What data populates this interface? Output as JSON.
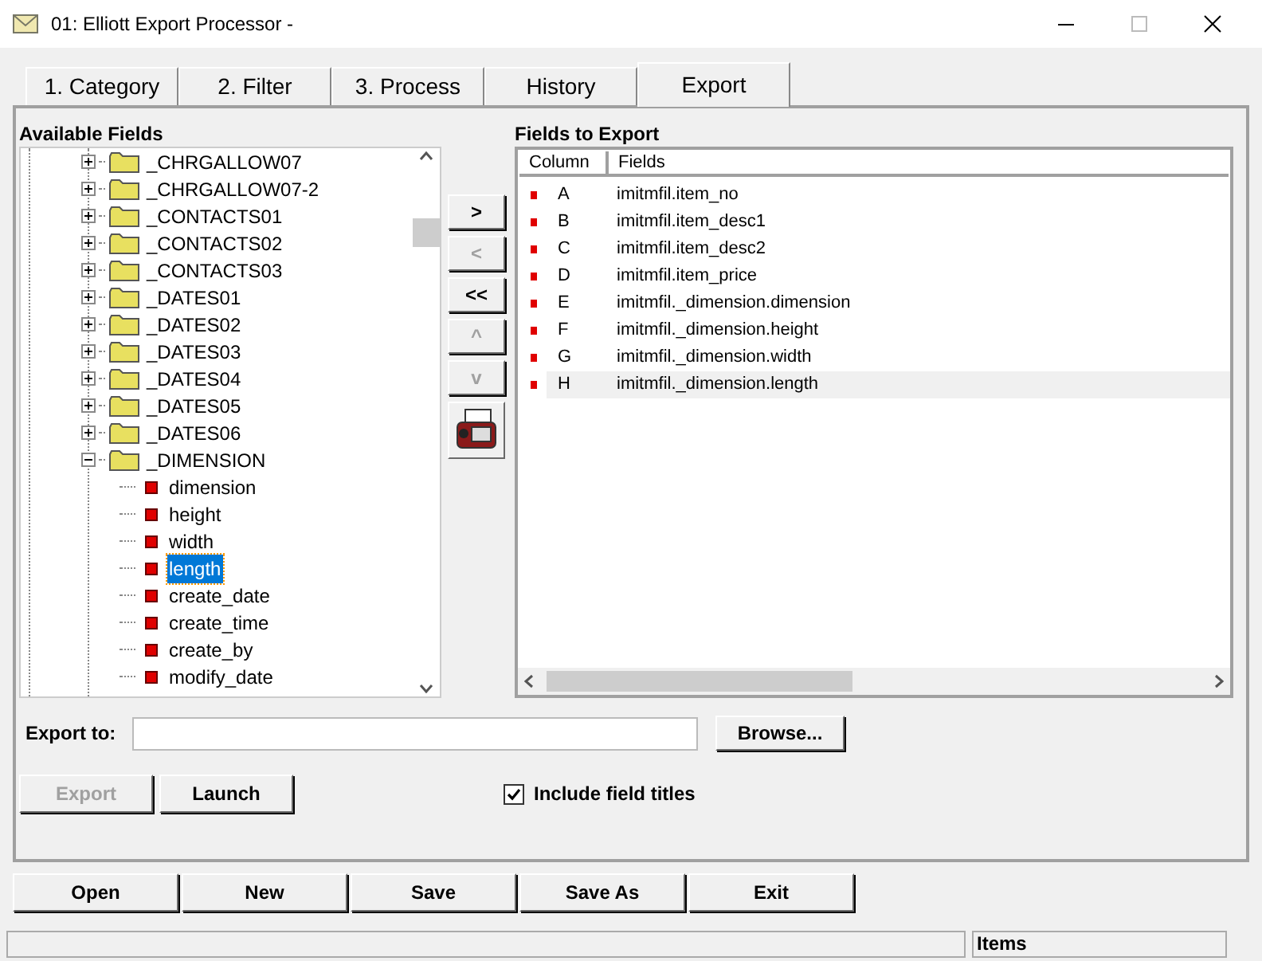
{
  "window": {
    "title": "01: Elliott Export Processor -"
  },
  "tabs": [
    {
      "label": "1. Category",
      "selected": false
    },
    {
      "label": "2. Filter",
      "selected": false
    },
    {
      "label": "3. Process",
      "selected": false
    },
    {
      "label": "History",
      "selected": false
    },
    {
      "label": "Export",
      "selected": true
    }
  ],
  "available_fields": {
    "label": "Available Fields",
    "items": [
      {
        "label": "_CHRGALLOW07",
        "expanded": false
      },
      {
        "label": "_CHRGALLOW07-2",
        "expanded": false
      },
      {
        "label": "_CONTACTS01",
        "expanded": false
      },
      {
        "label": "_CONTACTS02",
        "expanded": false
      },
      {
        "label": "_CONTACTS03",
        "expanded": false
      },
      {
        "label": "_DATES01",
        "expanded": false
      },
      {
        "label": "_DATES02",
        "expanded": false
      },
      {
        "label": "_DATES03",
        "expanded": false
      },
      {
        "label": "_DATES04",
        "expanded": false
      },
      {
        "label": "_DATES05",
        "expanded": false
      },
      {
        "label": "_DATES06",
        "expanded": false
      },
      {
        "label": "_DIMENSION",
        "expanded": true,
        "children": [
          {
            "label": "dimension",
            "selected": false
          },
          {
            "label": "height",
            "selected": false
          },
          {
            "label": "width",
            "selected": false
          },
          {
            "label": "length",
            "selected": true
          },
          {
            "label": "create_date",
            "selected": false
          },
          {
            "label": "create_time",
            "selected": false
          },
          {
            "label": "create_by",
            "selected": false
          },
          {
            "label": "modify_date",
            "selected": false
          }
        ]
      }
    ]
  },
  "move_buttons": [
    {
      "label": ">",
      "disabled": false
    },
    {
      "label": "<",
      "disabled": true
    },
    {
      "label": "<<",
      "disabled": false
    },
    {
      "label": "^",
      "disabled": true
    },
    {
      "label": "v",
      "disabled": true
    }
  ],
  "fields_to_export": {
    "label": "Fields to Export",
    "columns": [
      "Column",
      "Fields"
    ],
    "rows": [
      {
        "column": "A",
        "field": "imitmfil.item_no",
        "selected": false
      },
      {
        "column": "B",
        "field": "imitmfil.item_desc1",
        "selected": false
      },
      {
        "column": "C",
        "field": "imitmfil.item_desc2",
        "selected": false
      },
      {
        "column": "D",
        "field": "imitmfil.item_price",
        "selected": false
      },
      {
        "column": "E",
        "field": "imitmfil._dimension.dimension",
        "selected": false
      },
      {
        "column": "F",
        "field": "imitmfil._dimension.height",
        "selected": false
      },
      {
        "column": "G",
        "field": "imitmfil._dimension.width",
        "selected": false
      },
      {
        "column": "H",
        "field": "imitmfil._dimension.length",
        "selected": true
      }
    ]
  },
  "export_to": {
    "label": "Export to:",
    "browse": "Browse..."
  },
  "actions": [
    {
      "label": "Export",
      "disabled": true
    },
    {
      "label": "Launch",
      "disabled": false
    }
  ],
  "include_titles": {
    "label": "Include field titles",
    "checked": true
  },
  "bottom_buttons": [
    "Open",
    "New",
    "Save",
    "Save As",
    "Exit"
  ],
  "status_bar": {
    "items": "Items"
  }
}
